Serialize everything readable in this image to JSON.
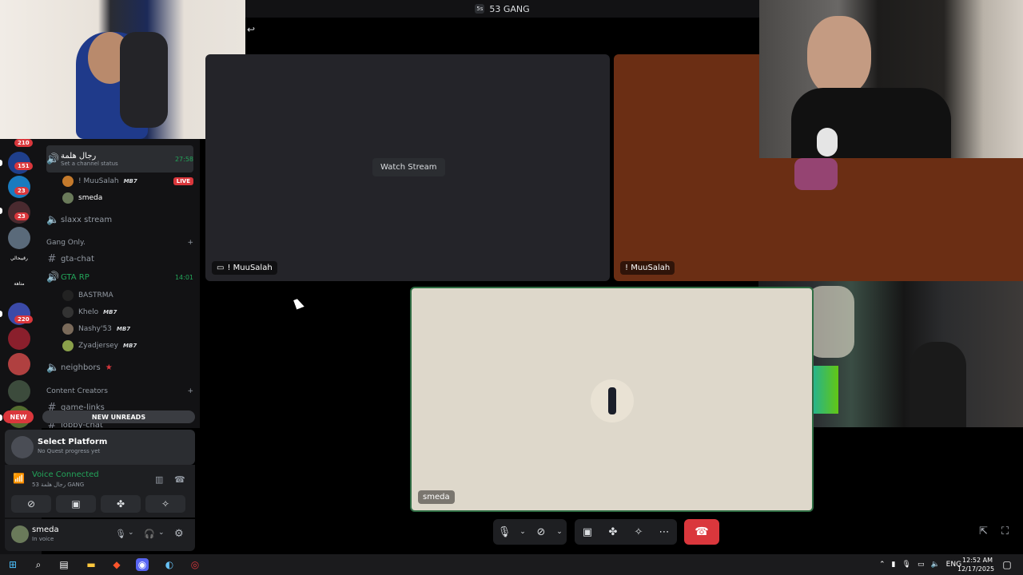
{
  "window": {
    "title": "53 GANG",
    "server_tag": "5s"
  },
  "rail": {
    "badges": [
      "210",
      "151",
      "23",
      "23",
      "220"
    ],
    "server_labels": [
      "رقيبحالي",
      "متاهة"
    ],
    "new_pill": "NEW"
  },
  "channels": {
    "active_voice": {
      "name": "رجال هلمة",
      "status": "Set a channel status",
      "timer": "27:58"
    },
    "active_users": [
      {
        "name": "! MuuSalah",
        "tag": "MB7",
        "live": "LIVE"
      },
      {
        "name": "smeda"
      }
    ],
    "slaxx": "slaxx stream",
    "cat_gang": "Gang Only.",
    "gta_chat": "gta-chat",
    "gta_rp": {
      "name": "GTA RP",
      "timer": "14:01"
    },
    "gta_users": [
      {
        "name": "BASTRMA",
        "tag": ""
      },
      {
        "name": "Khelo",
        "tag": "MB7"
      },
      {
        "name": "Nashy'53",
        "tag": "MB7"
      },
      {
        "name": "Zyadjersey",
        "tag": "MB7"
      }
    ],
    "neighbors": "neighbors",
    "cat_content": "Content Creators",
    "game_links": "game-links",
    "lobby_chat": "lobby-chat",
    "new_unreads": "NEW UNREADS"
  },
  "quest": {
    "title": "Select Platform",
    "subtitle": "No Quest progress yet"
  },
  "voice": {
    "status": "Voice Connected",
    "location": "53 رجال هلمة GANG"
  },
  "user": {
    "name": "smeda",
    "status": "In voice"
  },
  "stage": {
    "watch_stream": "Watch Stream",
    "tile1_label": "! MuuSalah",
    "tile2_label": "! MuuSalah",
    "tile3_label": "smeda"
  },
  "taskbar": {
    "lang": "ENG",
    "time": "12:52 AM",
    "date": "12/17/2025"
  }
}
